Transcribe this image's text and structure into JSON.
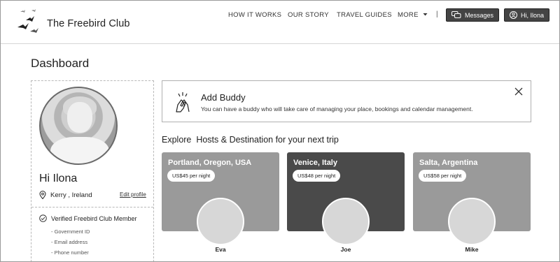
{
  "header": {
    "brand": "The Freebird Club",
    "nav": [
      "HOW IT WORKS",
      "OUR STORY",
      "TRAVEL GUIDES",
      "MORE"
    ],
    "separator": "|",
    "messages_label": "Messages",
    "user_label": "Hi, Ilona"
  },
  "page": {
    "title": "Dashboard"
  },
  "profile": {
    "greeting": "Hi Ilona",
    "location": "Kerry , Ireland",
    "edit_link": "Edit profile",
    "verified_title": "Verified Freebird Club Member",
    "verified_items": [
      "- Government ID",
      "- Email address",
      "- Phone number"
    ]
  },
  "buddy": {
    "title": "Add Buddy",
    "description": "You can have a buddy who will take care of managing your place, bookings and calendar management."
  },
  "explore": {
    "title": "Explore  Hosts & Destination for your next trip",
    "hosts": [
      {
        "destination": "Portland, Oregon, USA",
        "price": "US$45 per night",
        "name": "Eva",
        "color": "#9a9a9a"
      },
      {
        "destination": "Venice, Italy",
        "price": "US$48 per night",
        "name": "Joe",
        "color": "#4a4a4a"
      },
      {
        "destination": "Salta, Argentina",
        "price": "US$58 per night",
        "name": "Mike",
        "color": "#9a9a9a"
      }
    ]
  },
  "icons": [
    "bird-logo-icon",
    "chevron-down-icon",
    "chat-icon",
    "user-icon",
    "location-pin-icon",
    "check-circle-icon",
    "high-five-icon",
    "close-icon"
  ]
}
